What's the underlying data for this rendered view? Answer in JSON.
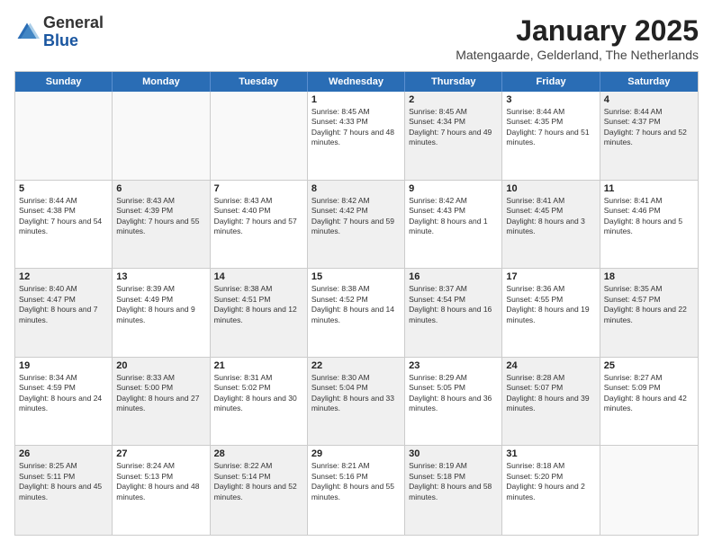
{
  "logo": {
    "general": "General",
    "blue": "Blue"
  },
  "header": {
    "title": "January 2025",
    "subtitle": "Matengaarde, Gelderland, The Netherlands"
  },
  "weekdays": [
    "Sunday",
    "Monday",
    "Tuesday",
    "Wednesday",
    "Thursday",
    "Friday",
    "Saturday"
  ],
  "weeks": [
    [
      {
        "day": "",
        "sunrise": "",
        "sunset": "",
        "daylight": "",
        "shaded": false,
        "empty": true
      },
      {
        "day": "",
        "sunrise": "",
        "sunset": "",
        "daylight": "",
        "shaded": false,
        "empty": true
      },
      {
        "day": "",
        "sunrise": "",
        "sunset": "",
        "daylight": "",
        "shaded": false,
        "empty": true
      },
      {
        "day": "1",
        "sunrise": "Sunrise: 8:45 AM",
        "sunset": "Sunset: 4:33 PM",
        "daylight": "Daylight: 7 hours and 48 minutes.",
        "shaded": false,
        "empty": false
      },
      {
        "day": "2",
        "sunrise": "Sunrise: 8:45 AM",
        "sunset": "Sunset: 4:34 PM",
        "daylight": "Daylight: 7 hours and 49 minutes.",
        "shaded": true,
        "empty": false
      },
      {
        "day": "3",
        "sunrise": "Sunrise: 8:44 AM",
        "sunset": "Sunset: 4:35 PM",
        "daylight": "Daylight: 7 hours and 51 minutes.",
        "shaded": false,
        "empty": false
      },
      {
        "day": "4",
        "sunrise": "Sunrise: 8:44 AM",
        "sunset": "Sunset: 4:37 PM",
        "daylight": "Daylight: 7 hours and 52 minutes.",
        "shaded": true,
        "empty": false
      }
    ],
    [
      {
        "day": "5",
        "sunrise": "Sunrise: 8:44 AM",
        "sunset": "Sunset: 4:38 PM",
        "daylight": "Daylight: 7 hours and 54 minutes.",
        "shaded": false,
        "empty": false
      },
      {
        "day": "6",
        "sunrise": "Sunrise: 8:43 AM",
        "sunset": "Sunset: 4:39 PM",
        "daylight": "Daylight: 7 hours and 55 minutes.",
        "shaded": true,
        "empty": false
      },
      {
        "day": "7",
        "sunrise": "Sunrise: 8:43 AM",
        "sunset": "Sunset: 4:40 PM",
        "daylight": "Daylight: 7 hours and 57 minutes.",
        "shaded": false,
        "empty": false
      },
      {
        "day": "8",
        "sunrise": "Sunrise: 8:42 AM",
        "sunset": "Sunset: 4:42 PM",
        "daylight": "Daylight: 7 hours and 59 minutes.",
        "shaded": true,
        "empty": false
      },
      {
        "day": "9",
        "sunrise": "Sunrise: 8:42 AM",
        "sunset": "Sunset: 4:43 PM",
        "daylight": "Daylight: 8 hours and 1 minute.",
        "shaded": false,
        "empty": false
      },
      {
        "day": "10",
        "sunrise": "Sunrise: 8:41 AM",
        "sunset": "Sunset: 4:45 PM",
        "daylight": "Daylight: 8 hours and 3 minutes.",
        "shaded": true,
        "empty": false
      },
      {
        "day": "11",
        "sunrise": "Sunrise: 8:41 AM",
        "sunset": "Sunset: 4:46 PM",
        "daylight": "Daylight: 8 hours and 5 minutes.",
        "shaded": false,
        "empty": false
      }
    ],
    [
      {
        "day": "12",
        "sunrise": "Sunrise: 8:40 AM",
        "sunset": "Sunset: 4:47 PM",
        "daylight": "Daylight: 8 hours and 7 minutes.",
        "shaded": true,
        "empty": false
      },
      {
        "day": "13",
        "sunrise": "Sunrise: 8:39 AM",
        "sunset": "Sunset: 4:49 PM",
        "daylight": "Daylight: 8 hours and 9 minutes.",
        "shaded": false,
        "empty": false
      },
      {
        "day": "14",
        "sunrise": "Sunrise: 8:38 AM",
        "sunset": "Sunset: 4:51 PM",
        "daylight": "Daylight: 8 hours and 12 minutes.",
        "shaded": true,
        "empty": false
      },
      {
        "day": "15",
        "sunrise": "Sunrise: 8:38 AM",
        "sunset": "Sunset: 4:52 PM",
        "daylight": "Daylight: 8 hours and 14 minutes.",
        "shaded": false,
        "empty": false
      },
      {
        "day": "16",
        "sunrise": "Sunrise: 8:37 AM",
        "sunset": "Sunset: 4:54 PM",
        "daylight": "Daylight: 8 hours and 16 minutes.",
        "shaded": true,
        "empty": false
      },
      {
        "day": "17",
        "sunrise": "Sunrise: 8:36 AM",
        "sunset": "Sunset: 4:55 PM",
        "daylight": "Daylight: 8 hours and 19 minutes.",
        "shaded": false,
        "empty": false
      },
      {
        "day": "18",
        "sunrise": "Sunrise: 8:35 AM",
        "sunset": "Sunset: 4:57 PM",
        "daylight": "Daylight: 8 hours and 22 minutes.",
        "shaded": true,
        "empty": false
      }
    ],
    [
      {
        "day": "19",
        "sunrise": "Sunrise: 8:34 AM",
        "sunset": "Sunset: 4:59 PM",
        "daylight": "Daylight: 8 hours and 24 minutes.",
        "shaded": false,
        "empty": false
      },
      {
        "day": "20",
        "sunrise": "Sunrise: 8:33 AM",
        "sunset": "Sunset: 5:00 PM",
        "daylight": "Daylight: 8 hours and 27 minutes.",
        "shaded": true,
        "empty": false
      },
      {
        "day": "21",
        "sunrise": "Sunrise: 8:31 AM",
        "sunset": "Sunset: 5:02 PM",
        "daylight": "Daylight: 8 hours and 30 minutes.",
        "shaded": false,
        "empty": false
      },
      {
        "day": "22",
        "sunrise": "Sunrise: 8:30 AM",
        "sunset": "Sunset: 5:04 PM",
        "daylight": "Daylight: 8 hours and 33 minutes.",
        "shaded": true,
        "empty": false
      },
      {
        "day": "23",
        "sunrise": "Sunrise: 8:29 AM",
        "sunset": "Sunset: 5:05 PM",
        "daylight": "Daylight: 8 hours and 36 minutes.",
        "shaded": false,
        "empty": false
      },
      {
        "day": "24",
        "sunrise": "Sunrise: 8:28 AM",
        "sunset": "Sunset: 5:07 PM",
        "daylight": "Daylight: 8 hours and 39 minutes.",
        "shaded": true,
        "empty": false
      },
      {
        "day": "25",
        "sunrise": "Sunrise: 8:27 AM",
        "sunset": "Sunset: 5:09 PM",
        "daylight": "Daylight: 8 hours and 42 minutes.",
        "shaded": false,
        "empty": false
      }
    ],
    [
      {
        "day": "26",
        "sunrise": "Sunrise: 8:25 AM",
        "sunset": "Sunset: 5:11 PM",
        "daylight": "Daylight: 8 hours and 45 minutes.",
        "shaded": true,
        "empty": false
      },
      {
        "day": "27",
        "sunrise": "Sunrise: 8:24 AM",
        "sunset": "Sunset: 5:13 PM",
        "daylight": "Daylight: 8 hours and 48 minutes.",
        "shaded": false,
        "empty": false
      },
      {
        "day": "28",
        "sunrise": "Sunrise: 8:22 AM",
        "sunset": "Sunset: 5:14 PM",
        "daylight": "Daylight: 8 hours and 52 minutes.",
        "shaded": true,
        "empty": false
      },
      {
        "day": "29",
        "sunrise": "Sunrise: 8:21 AM",
        "sunset": "Sunset: 5:16 PM",
        "daylight": "Daylight: 8 hours and 55 minutes.",
        "shaded": false,
        "empty": false
      },
      {
        "day": "30",
        "sunrise": "Sunrise: 8:19 AM",
        "sunset": "Sunset: 5:18 PM",
        "daylight": "Daylight: 8 hours and 58 minutes.",
        "shaded": true,
        "empty": false
      },
      {
        "day": "31",
        "sunrise": "Sunrise: 8:18 AM",
        "sunset": "Sunset: 5:20 PM",
        "daylight": "Daylight: 9 hours and 2 minutes.",
        "shaded": false,
        "empty": false
      },
      {
        "day": "",
        "sunrise": "",
        "sunset": "",
        "daylight": "",
        "shaded": true,
        "empty": true
      }
    ]
  ]
}
